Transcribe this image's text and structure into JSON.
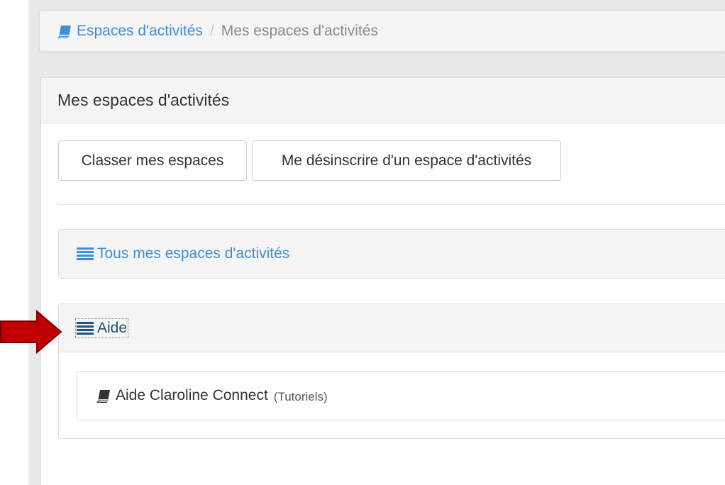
{
  "breadcrumb": {
    "root_label": "Espaces d'activités",
    "separator": "/",
    "current_label": "Mes espaces d'activités"
  },
  "panel": {
    "title": "Mes espaces d'activités",
    "buttons": {
      "sort_label": "Classer mes espaces",
      "unsubscribe_label": "Me désinscrire d'un espace d'activités"
    }
  },
  "groups": [
    {
      "label": "Tous mes espaces d'activités",
      "icon": "list-icon"
    },
    {
      "label": "Aide",
      "icon": "list-icon",
      "items": [
        {
          "name": "Aide Claroline Connect",
          "sub": "(Tutoriels)",
          "icon": "book-icon"
        }
      ]
    }
  ],
  "annotation": {
    "icon": "red-arrow-icon",
    "color": "#c00000"
  },
  "colors": {
    "link": "#3f8ed8",
    "link_focused": "#21507a",
    "heading_bg": "#f5f5f5"
  }
}
